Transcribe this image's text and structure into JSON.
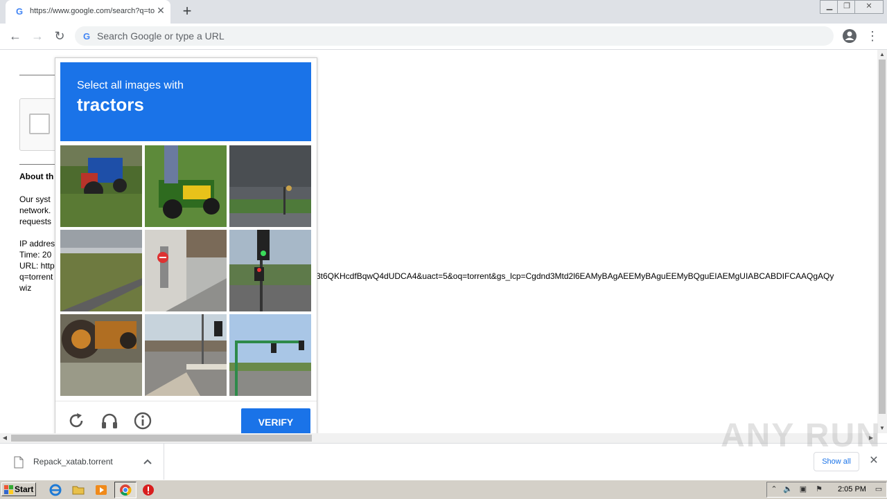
{
  "browser": {
    "tab_title": "https://www.google.com/search?q=torrent",
    "address_placeholder": "Search Google or type a URL"
  },
  "page": {
    "about_heading": "About th",
    "para1": [
      "Our syst",
      "network.",
      "requests"
    ],
    "para2": [
      "IP addres",
      "Time: 20",
      "URL: http",
      "q=torrent",
      "wiz"
    ],
    "url_fragment": "3t6QKHcdfBqwQ4dUDCA4&uact=5&oq=torrent&gs_lcp=Cgdnd3Mtd2l6EAMyBAgAEEMyBAguEEMyBQguEIAEMgUIABCABDIFCAAQgAQy"
  },
  "captcha": {
    "instruction": "Select all images with",
    "target": "tractors",
    "tiles": [
      "tractor-blue-field",
      "riding-mower-green",
      "storm-sky-street",
      "plowed-field-road",
      "sidewalk-no-entry-sign",
      "traffic-light-palm-street",
      "tractor-wheel-closeup",
      "intersection-traffic-lights",
      "intersection-green-signal"
    ],
    "verify_label": "VERIFY"
  },
  "downloads": {
    "file_name": "Repack_xatab.torrent",
    "show_all_label": "Show all"
  },
  "watermark": "ANY RUN",
  "taskbar": {
    "start_label": "Start",
    "clock": "2:05 PM"
  },
  "colors": {
    "accent": "#1a73e8",
    "tab_strip": "#dee1e6",
    "taskbar": "#d4d0c8"
  }
}
